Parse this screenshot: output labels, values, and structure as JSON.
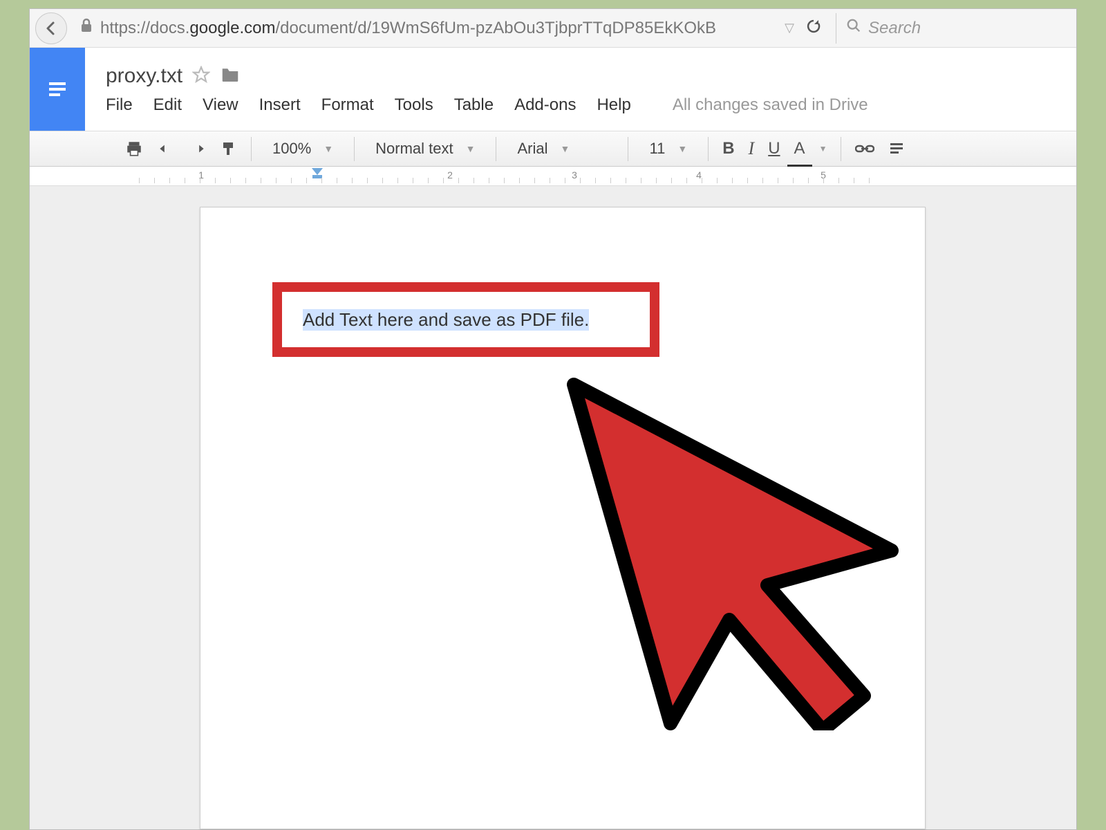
{
  "browser": {
    "url_prefix": "https://docs.",
    "url_domain": "google.com",
    "url_path": "/document/d/19WmS6fUm-pzAbOu3TjbprTTqDP85EkKOkB",
    "search_placeholder": "Search"
  },
  "doc": {
    "title": "proxy.txt",
    "save_status": "All changes saved in Drive"
  },
  "menus": {
    "file": "File",
    "edit": "Edit",
    "view": "View",
    "insert": "Insert",
    "format": "Format",
    "tools": "Tools",
    "table": "Table",
    "addons": "Add-ons",
    "help": "Help"
  },
  "toolbar": {
    "zoom": "100%",
    "style": "Normal text",
    "font": "Arial",
    "size": "11",
    "bold": "B",
    "italic": "I",
    "underline": "U",
    "textcolor": "A"
  },
  "ruler": {
    "n1": "1",
    "n2": "2",
    "n3": "3",
    "n4": "4",
    "n5": "5"
  },
  "content": {
    "selected_text": "Add Text here and save as PDF file."
  }
}
